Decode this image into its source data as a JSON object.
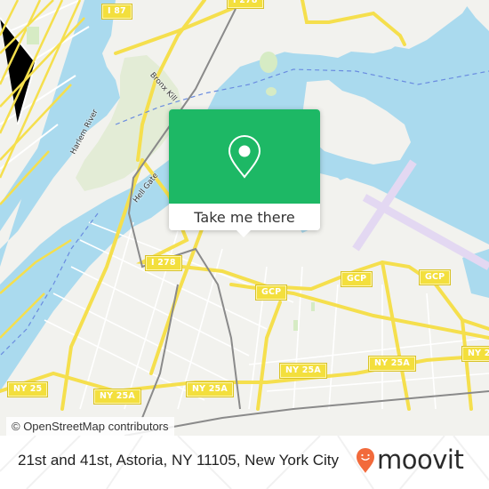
{
  "map": {
    "colors": {
      "land": "#f2f2ee",
      "water": "#aadaee",
      "park": "#d6ebc4",
      "road_major": "#f5df4d",
      "road_minor": "#ffffff",
      "rail": "#8a8a8a",
      "airport": "#e8e0f3",
      "ferry": "#6a8ce0"
    },
    "shields": [
      {
        "id": "i87",
        "label": "I 87"
      },
      {
        "id": "i278-top",
        "label": "I 278"
      },
      {
        "id": "i278",
        "label": "I 278"
      },
      {
        "id": "gcp-1",
        "label": "GCP"
      },
      {
        "id": "gcp-2",
        "label": "GCP"
      },
      {
        "id": "gcp-3",
        "label": "GCP"
      },
      {
        "id": "ny25",
        "label": "NY 25"
      },
      {
        "id": "ny25a-1",
        "label": "NY 25A"
      },
      {
        "id": "ny25a-2",
        "label": "NY 25A"
      },
      {
        "id": "ny25a-3",
        "label": "NY 25A"
      },
      {
        "id": "ny25a-4",
        "label": "NY 25A"
      }
    ],
    "water_labels": [
      {
        "id": "harlem-river",
        "label": "Harlem River"
      },
      {
        "id": "bronx-kill",
        "label": "Bronx Kill"
      },
      {
        "id": "hell-gate",
        "label": "Hell Gate"
      }
    ]
  },
  "popup": {
    "icon": "map-pin-icon",
    "button_label": "Take me there",
    "color": "#1db865"
  },
  "attribution": "© OpenStreetMap contributors",
  "footer": {
    "address": "21st and 41st, Astoria, NY 11105, New York City",
    "brand": "moovit",
    "brand_icon": "moovit-pin-icon",
    "brand_color": "#f26a3b"
  }
}
